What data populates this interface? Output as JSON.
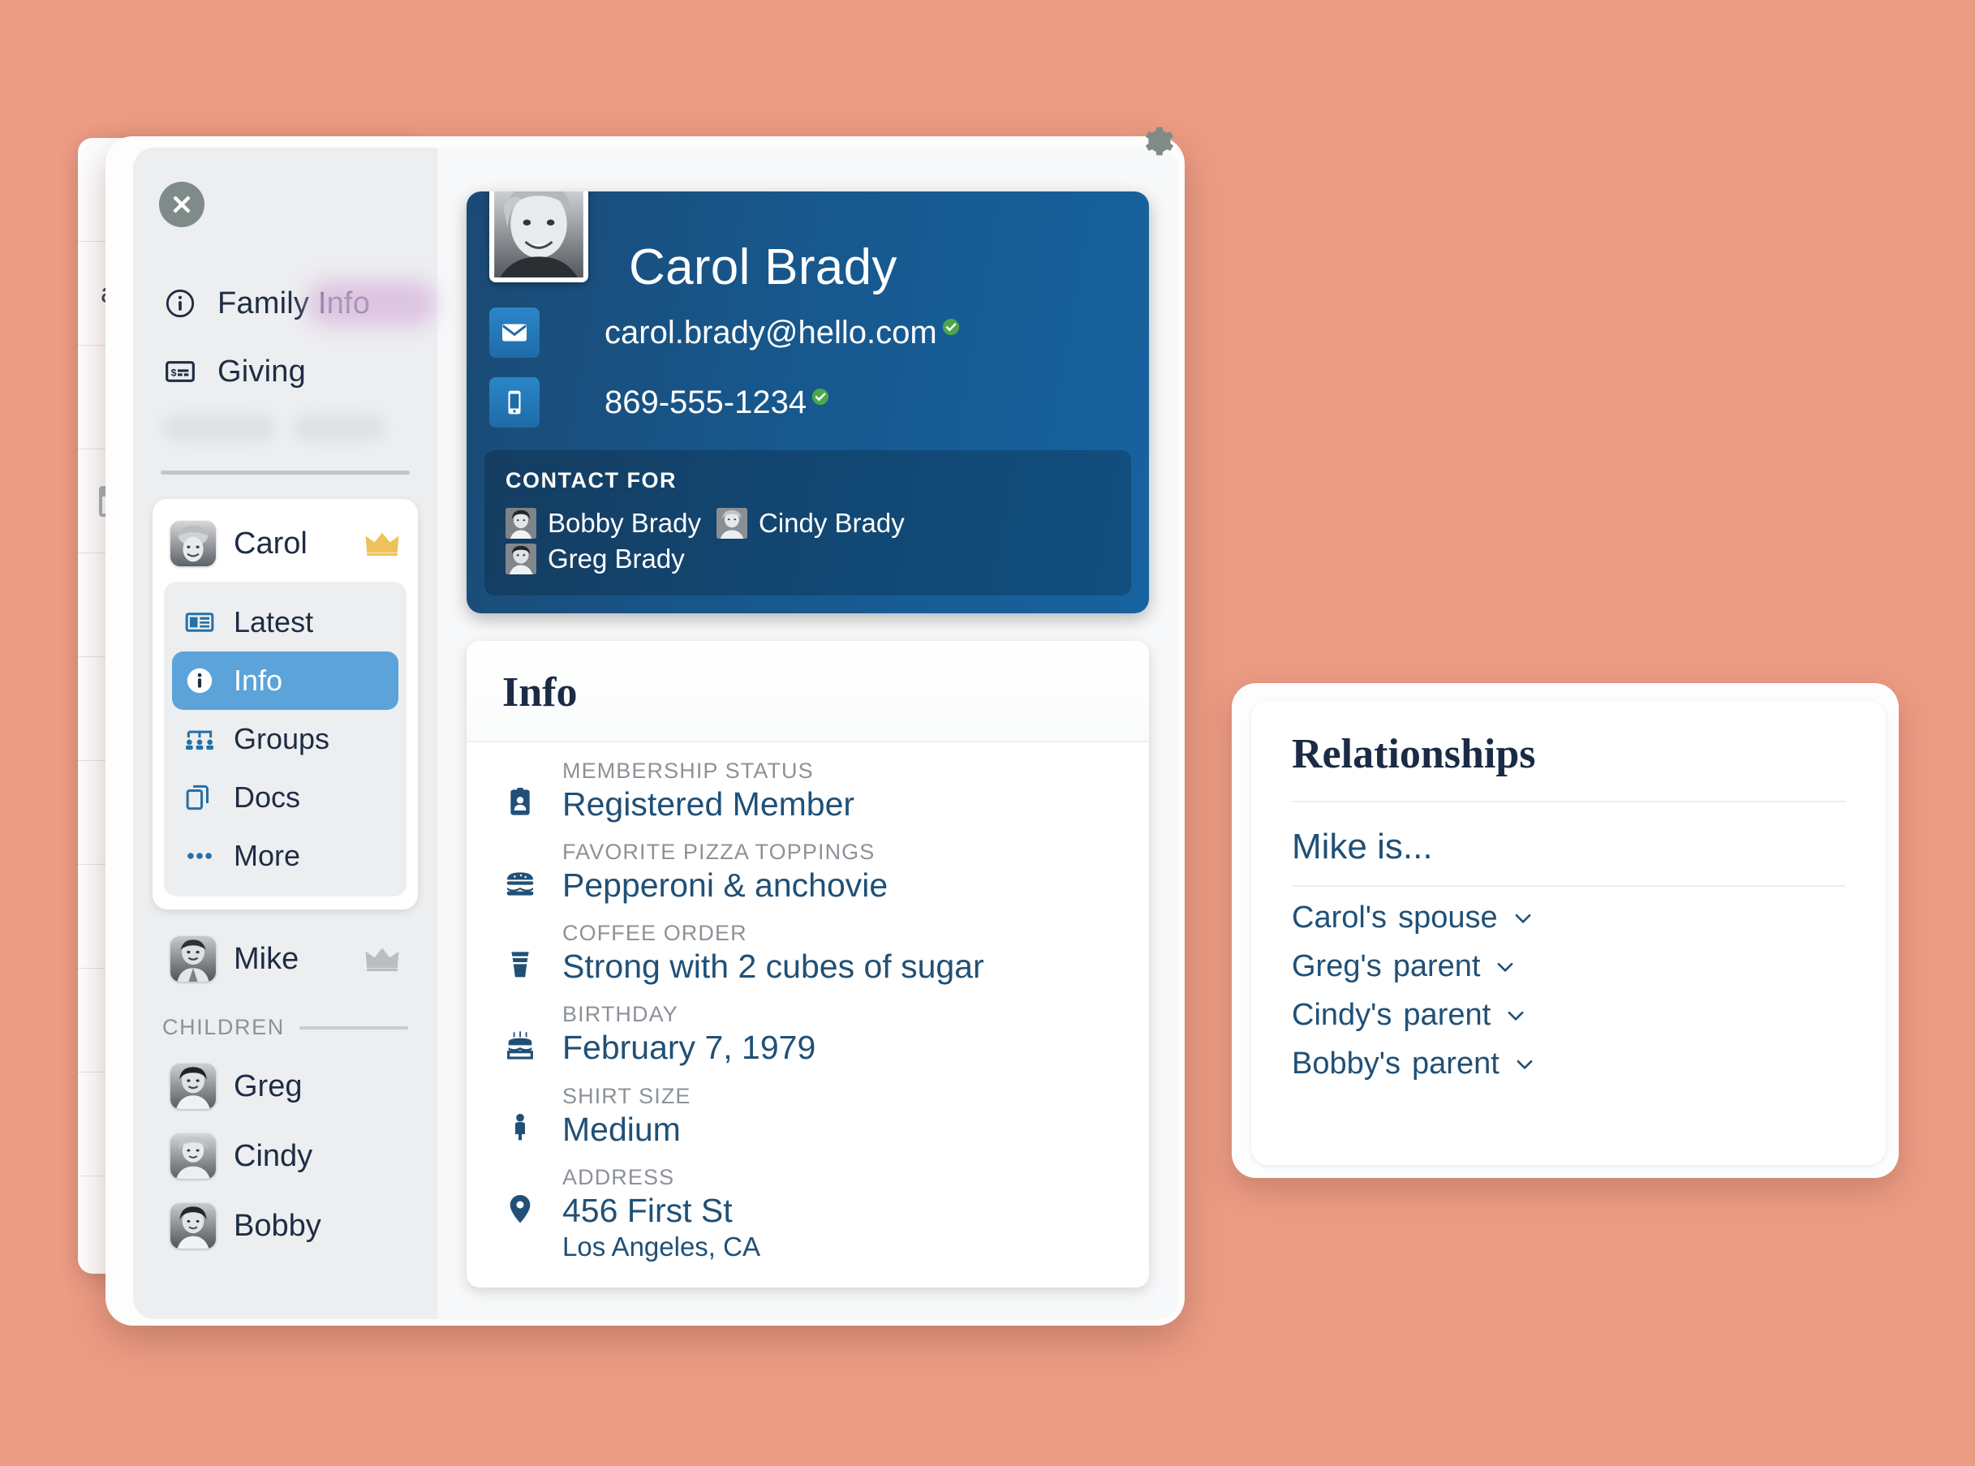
{
  "theme": {
    "background": "#ed9c84",
    "accent_blue": "#5ba3d9",
    "header_blue_dark": "#1b4a75",
    "header_blue_light": "#1763a0",
    "text_navy": "#1f2c43",
    "value_blue": "#205077",
    "label_grey": "#8c9298",
    "crown_gold": "#eec25a",
    "crown_grey": "#b9bec2",
    "verified_green": "#4aa84a"
  },
  "background_window": {
    "partial_text": "arc",
    "calendar_icon": "calendar-icon"
  },
  "window": {
    "close_label": "close-icon",
    "gear_label": "gear-icon"
  },
  "sidebar": {
    "nav": [
      {
        "label": "Family Info",
        "icon": "info-circle-icon",
        "highlighted": true
      },
      {
        "label": "Giving",
        "icon": "check-payment-icon",
        "highlighted": false
      }
    ],
    "people": [
      {
        "name": "Carol",
        "avatar": "carol-avatar",
        "crown": "gold",
        "expanded": true
      },
      {
        "name": "Mike",
        "avatar": "mike-avatar",
        "crown": "grey",
        "expanded": false
      }
    ],
    "carol_submenu": [
      {
        "label": "Latest",
        "icon": "newspaper-icon",
        "selected": false
      },
      {
        "label": "Info",
        "icon": "info-circle-icon",
        "selected": true
      },
      {
        "label": "Groups",
        "icon": "groups-icon",
        "selected": false
      },
      {
        "label": "Docs",
        "icon": "documents-icon",
        "selected": false
      },
      {
        "label": "More",
        "icon": "ellipsis-icon",
        "selected": false
      }
    ],
    "children_heading": "CHILDREN",
    "children": [
      {
        "name": "Greg",
        "avatar": "greg-avatar"
      },
      {
        "name": "Cindy",
        "avatar": "cindy-avatar"
      },
      {
        "name": "Bobby",
        "avatar": "bobby-avatar"
      }
    ]
  },
  "profile": {
    "name": "Carol Brady",
    "photo": "carol-profile-photo",
    "email": "carol.brady@hello.com",
    "email_verified": true,
    "phone": "869-555-1234",
    "phone_verified": true,
    "contact_for_title": "CONTACT FOR",
    "contact_for": [
      {
        "name": "Bobby Brady",
        "avatar": "bobby-avatar"
      },
      {
        "name": "Cindy Brady",
        "avatar": "cindy-avatar"
      },
      {
        "name": "Greg Brady",
        "avatar": "greg-avatar"
      }
    ]
  },
  "info": {
    "title": "Info",
    "fields": [
      {
        "label": "MEMBERSHIP STATUS",
        "value": "Registered Member",
        "value2": "",
        "icon": "id-badge-icon"
      },
      {
        "label": "FAVORITE PIZZA TOPPINGS",
        "value": "Pepperoni & anchovie",
        "value2": "",
        "icon": "burger-icon"
      },
      {
        "label": "COFFEE ORDER",
        "value": "Strong with 2 cubes of sugar",
        "value2": "",
        "icon": "coffee-cup-icon"
      },
      {
        "label": "BIRTHDAY",
        "value": "February 7, 1979",
        "value2": "",
        "icon": "birthday-cake-icon"
      },
      {
        "label": "SHIRT SIZE",
        "value": "Medium",
        "value2": "",
        "icon": "person-icon"
      },
      {
        "label": "ADDRESS",
        "value": "456 First St",
        "value2": "Los Angeles, CA",
        "icon": "map-pin-icon"
      }
    ]
  },
  "relationships": {
    "title": "Relationships",
    "subject": "Mike is...",
    "items": [
      {
        "person": "Carol's",
        "role": "spouse"
      },
      {
        "person": "Greg's",
        "role": "parent"
      },
      {
        "person": "Cindy's",
        "role": "parent"
      },
      {
        "person": "Bobby's",
        "role": "parent"
      }
    ]
  }
}
